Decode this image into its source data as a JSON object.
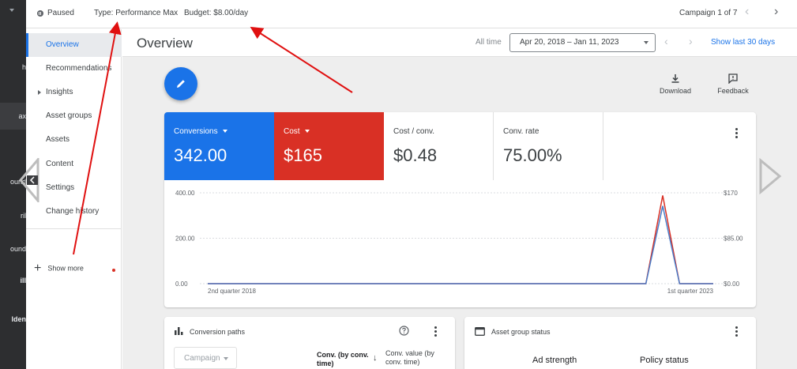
{
  "rail": {
    "items": [
      {
        "label": "h",
        "active": false
      },
      {
        "label": "ax",
        "active": true
      },
      {
        "label": "ound",
        "active": false
      },
      {
        "label": "ril",
        "active": false
      },
      {
        "label": "ound",
        "active": false
      },
      {
        "label": "ill",
        "active": false
      },
      {
        "label": "lden",
        "active": false
      }
    ]
  },
  "topbar": {
    "status": "Paused",
    "type": "Type: Performance Max",
    "budget": "Budget: $8.00/day",
    "campaign_counter": "Campaign 1 of 7",
    "prev_icon": "chevron-left-icon",
    "next_icon": "chevron-right-icon"
  },
  "subnav": {
    "items": [
      {
        "label": "Overview",
        "active": true,
        "expandable": false
      },
      {
        "label": "Recommendations",
        "active": false,
        "expandable": false
      },
      {
        "label": "Insights",
        "active": false,
        "expandable": true
      },
      {
        "label": "Asset groups",
        "active": false,
        "expandable": false
      },
      {
        "label": "Assets",
        "active": false,
        "expandable": false
      },
      {
        "label": "Content",
        "active": false,
        "expandable": false
      },
      {
        "label": "Settings",
        "active": false,
        "expandable": false
      },
      {
        "label": "Change history",
        "active": false,
        "expandable": false
      }
    ],
    "show_more": "Show more"
  },
  "header": {
    "title": "Overview",
    "all_time": "All time",
    "date_range": "Apr 20, 2018 – Jan 11, 2023",
    "show_last": "Show last 30 days"
  },
  "tools": {
    "download": "Download",
    "feedback": "Feedback"
  },
  "metrics": [
    {
      "label": "Conversions",
      "value": "342.00",
      "color": "#1a73e8",
      "selectable": true
    },
    {
      "label": "Cost",
      "value": "$165",
      "color": "#d93025",
      "selectable": true
    },
    {
      "label": "Cost / conv.",
      "value": "$0.48",
      "selectable": false
    },
    {
      "label": "Conv. rate",
      "value": "75.00%",
      "selectable": false
    }
  ],
  "chart_data": {
    "type": "line",
    "x": [
      "2nd quarter 2018",
      "",
      "",
      "",
      "",
      "",
      "",
      "",
      "",
      "",
      "",
      "",
      "",
      "",
      "",
      "",
      "",
      "",
      "",
      "",
      "",
      "",
      "",
      "",
      "",
      "",
      "",
      "",
      "",
      "",
      "1st quarter 2023"
    ],
    "x_tick_labels": [
      "2nd quarter 2018",
      "1st quarter 2023"
    ],
    "left_axis": {
      "ticks": [
        "0.00",
        "200.00",
        "400.00"
      ],
      "ylim": [
        0,
        400
      ]
    },
    "right_axis": {
      "ticks": [
        "$0.00",
        "$85.00",
        "$170"
      ],
      "ylim": [
        0,
        170
      ]
    },
    "series": [
      {
        "name": "Conversions",
        "axis": "left",
        "color": "#4a7dc9",
        "values": [
          0,
          0,
          0,
          0,
          0,
          0,
          0,
          0,
          0,
          0,
          0,
          0,
          0,
          0,
          0,
          0,
          0,
          0,
          0,
          0,
          0,
          0,
          0,
          0,
          0,
          0,
          0,
          342,
          0,
          0,
          0
        ]
      },
      {
        "name": "Cost",
        "axis": "right",
        "color": "#d93025",
        "values": [
          0,
          0,
          0,
          0,
          0,
          0,
          0,
          0,
          0,
          0,
          0,
          0,
          0,
          0,
          0,
          0,
          0,
          0,
          0,
          0,
          0,
          0,
          0,
          0,
          0,
          0,
          0,
          165,
          0,
          0,
          0
        ]
      }
    ],
    "grid": true
  },
  "conversion_paths": {
    "title": "Conversion paths",
    "select_placeholder": "Campaign",
    "col1": "Conv. (by conv. time)",
    "col2": "Conv. value (by conv. time)"
  },
  "asset_group_status": {
    "title": "Asset group status",
    "col1": "Ad strength",
    "col2": "Policy status"
  }
}
